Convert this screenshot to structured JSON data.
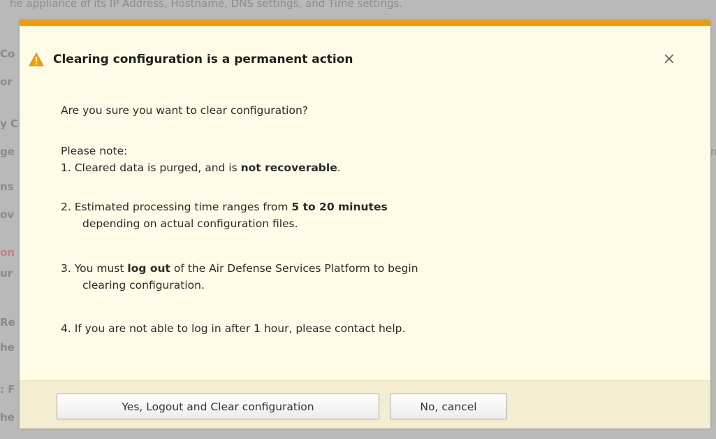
{
  "background": {
    "top_text": "he appliance of its IP Address, Hostname, DNS settings, and Time settings.",
    "fragments": [
      "Co",
      "or",
      "y C",
      "ge",
      "ns",
      "ov",
      "on",
      "ur",
      "Re",
      "he",
      ": F",
      "he"
    ],
    "right_fragment": "n"
  },
  "dialog": {
    "title": "Clearing configuration is a permanent action",
    "question": "Are you sure you want to clear configuration?",
    "note_heading": "Please note:",
    "item1": {
      "prefix": "1. Cleared data is purged, and is ",
      "bold": "not recoverable",
      "suffix": "."
    },
    "item2": {
      "prefix": "2. Estimated processing time ranges from ",
      "bold": "5 to 20 minutes",
      "line2": "depending on actual configuration files."
    },
    "item3": {
      "prefix": "3. You must ",
      "bold": "log out",
      "suffix": " of the Air Defense Services Platform to begin",
      "line2": "clearing configuration."
    },
    "item4": "4. If you are not able to log in after 1 hour, please contact help.",
    "confirm_label": "Yes, Logout and Clear configuration",
    "cancel_label": "No, cancel"
  },
  "colors": {
    "accent": "#f59a00",
    "dialog_bg": "#fffbe6",
    "footer_bg": "#f5edcf"
  },
  "icons": {
    "warning": "warning-icon",
    "close": "close-icon"
  }
}
